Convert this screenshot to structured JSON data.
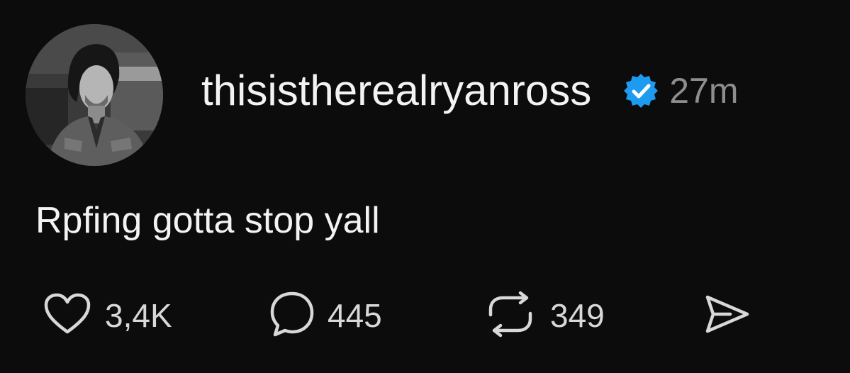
{
  "post": {
    "author": {
      "username": "thisistherealryanross",
      "verified": true,
      "avatar_icon": "profile-photo"
    },
    "timestamp": "27m",
    "text": "Rpfing gotta stop yall",
    "actions": {
      "likes": {
        "icon": "heart-icon",
        "count": "3,4K"
      },
      "replies": {
        "icon": "speech-bubble-icon",
        "count": "445"
      },
      "reposts": {
        "icon": "repost-icon",
        "count": "349"
      },
      "share": {
        "icon": "send-icon"
      }
    }
  },
  "colors": {
    "background": "#0c0c0c",
    "text": "#f3f3f3",
    "muted": "#8e8e8e",
    "verified_badge": "#1d9bf0"
  }
}
